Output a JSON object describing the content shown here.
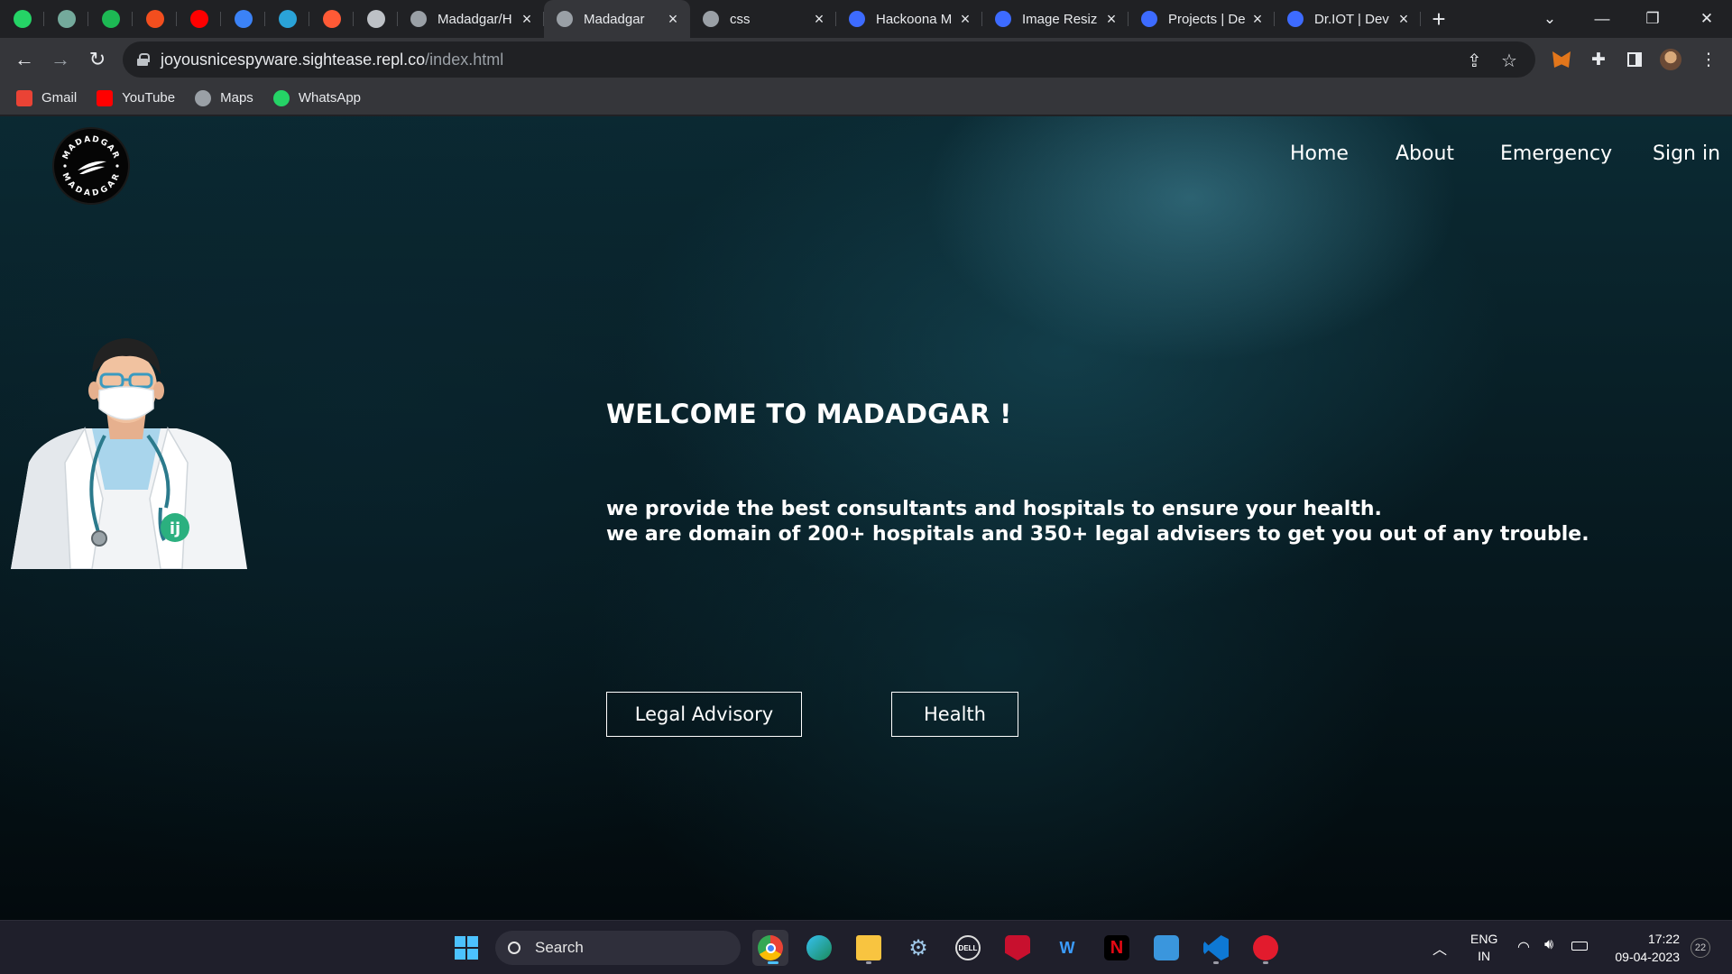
{
  "browser": {
    "pinned_tabs": [
      {
        "icon": "whatsapp-icon",
        "color": "#25d366"
      },
      {
        "icon": "chatgpt-icon",
        "color": "#74aa9c"
      },
      {
        "icon": "spotify-icon",
        "color": "#1db954"
      },
      {
        "icon": "figma-icon",
        "color": "#f24e1e"
      },
      {
        "icon": "youtube-icon",
        "color": "#ff0000"
      },
      {
        "icon": "replit-icon",
        "color": "#3b82f6"
      },
      {
        "icon": "telegram-icon",
        "color": "#2aa3d8"
      },
      {
        "icon": "asterisk-icon",
        "color": "#ff5a36"
      },
      {
        "icon": "github-icon",
        "color": "#bdc1c6"
      }
    ],
    "tabs": [
      {
        "title": "Madadgar/H",
        "active": false
      },
      {
        "title": "Madadgar",
        "active": true
      },
      {
        "title": "css",
        "active": false
      },
      {
        "title": "Hackoona M",
        "active": false
      },
      {
        "title": "Image Resiz",
        "active": false
      },
      {
        "title": "Projects | De",
        "active": false
      },
      {
        "title": "Dr.IOT | Dev",
        "active": false
      }
    ],
    "url_host": "joyousnicespyware.sightease.repl.co",
    "url_path": "/index.html",
    "bookmarks": [
      {
        "label": "Gmail",
        "icon": "gmail-icon",
        "color": "#ea4335"
      },
      {
        "label": "YouTube",
        "icon": "youtube-icon",
        "color": "#ff0000"
      },
      {
        "label": "Maps",
        "icon": "globe-icon",
        "color": "#9aa0a6"
      },
      {
        "label": "WhatsApp",
        "icon": "whatsapp-icon",
        "color": "#25d366"
      }
    ]
  },
  "site": {
    "logo_text": "MADADGAR",
    "nav": {
      "home": "Home",
      "about": "About",
      "emergency": "Emergency",
      "signin": "Sign in"
    },
    "welcome": "WELCOME TO MADADGAR !",
    "desc_line1": "we provide the best consultants and hospitals to ensure your health.",
    "desc_line2": "we are domain of 200+ hospitals and 350+ legal advisers to get you out of any trouble.",
    "btn_legal": "Legal Advisory",
    "btn_health": "Health"
  },
  "taskbar": {
    "search_label": "Search",
    "lang_line1": "ENG",
    "lang_line2": "IN",
    "time": "17:22",
    "date": "09-04-2023",
    "notif_count": "22"
  }
}
